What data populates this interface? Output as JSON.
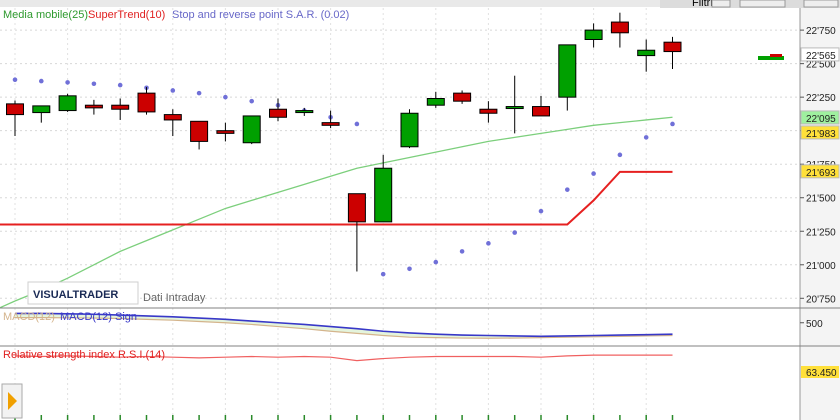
{
  "toolbar": {
    "filter_label": "Filtri"
  },
  "legend": {
    "ma": "Media mobile(25)",
    "st": "SuperTrend(10)",
    "sar": "Stop and reverse point S.A.R. (0.02)",
    "macd_a": "MACD(12)",
    "macd_b": "MACD(12) Sign",
    "rsi": "Relative strength index R.S.I.(14)"
  },
  "watermark": {
    "brand": "VISUALTRADER",
    "mode": "Dati Intraday"
  },
  "colors": {
    "up": "#00a000",
    "down": "#cc0000",
    "ma": "#7ccf7c",
    "st": "#e62020",
    "sar": "#7070d8",
    "macd": "#3838c8",
    "macd_sign": "#d4b48c",
    "rsi": "#f06060",
    "tag_yellow": "#ffe03a",
    "tag_green": "#9ff09f",
    "tag_white": "#ffffff"
  },
  "chart_data": {
    "type": "candlestick",
    "y_ticks": [
      "22'750",
      "22'500",
      "22'250",
      "22'000",
      "21'750",
      "21'500",
      "21'250",
      "21'000",
      "20'750"
    ],
    "tick_values": [
      22750,
      22500,
      22250,
      22000,
      21750,
      21500,
      21250,
      21000,
      20750
    ],
    "price_range": [
      20700,
      22900
    ],
    "candles": [
      {
        "o": 22200,
        "h": 22225,
        "l": 21960,
        "c": 22120
      },
      {
        "o": 22135,
        "h": 22185,
        "l": 22060,
        "c": 22185
      },
      {
        "o": 22150,
        "h": 22275,
        "l": 22140,
        "c": 22260
      },
      {
        "o": 22190,
        "h": 22230,
        "l": 22120,
        "c": 22170
      },
      {
        "o": 22190,
        "h": 22240,
        "l": 22080,
        "c": 22160
      },
      {
        "o": 22280,
        "h": 22325,
        "l": 22120,
        "c": 22140
      },
      {
        "o": 22120,
        "h": 22160,
        "l": 21960,
        "c": 22080
      },
      {
        "o": 22070,
        "h": 22070,
        "l": 21860,
        "c": 21920
      },
      {
        "o": 22000,
        "h": 22060,
        "l": 21920,
        "c": 21980
      },
      {
        "o": 21910,
        "h": 22110,
        "l": 21900,
        "c": 22110
      },
      {
        "o": 22160,
        "h": 22240,
        "l": 22070,
        "c": 22100
      },
      {
        "o": 22140,
        "h": 22170,
        "l": 22110,
        "c": 22150
      },
      {
        "o": 22060,
        "h": 22150,
        "l": 22020,
        "c": 22040
      },
      {
        "o": 21530,
        "h": 21530,
        "l": 20950,
        "c": 21320
      },
      {
        "o": 21320,
        "h": 21820,
        "l": 21320,
        "c": 21720
      },
      {
        "o": 21880,
        "h": 22160,
        "l": 21870,
        "c": 22130
      },
      {
        "o": 22190,
        "h": 22290,
        "l": 22170,
        "c": 22240
      },
      {
        "o": 22280,
        "h": 22300,
        "l": 22200,
        "c": 22220
      },
      {
        "o": 22160,
        "h": 22220,
        "l": 22060,
        "c": 22130
      },
      {
        "o": 22180,
        "h": 22410,
        "l": 21980,
        "c": 22180
      },
      {
        "o": 22180,
        "h": 22260,
        "l": 22120,
        "c": 22110
      },
      {
        "o": 22250,
        "h": 22520,
        "l": 22150,
        "c": 22640
      },
      {
        "o": 22680,
        "h": 22800,
        "l": 22620,
        "c": 22750
      },
      {
        "o": 22810,
        "h": 22880,
        "l": 22620,
        "c": 22730
      },
      {
        "o": 22560,
        "h": 22680,
        "l": 22440,
        "c": 22600
      },
      {
        "o": 22660,
        "h": 22700,
        "l": 22460,
        "c": 22590
      }
    ],
    "ma_line": [
      20730,
      20810,
      20900,
      21000,
      21100,
      21180,
      21260,
      21340,
      21420,
      21480,
      21540,
      21600,
      21660,
      21720,
      21760,
      21800,
      21840,
      21880,
      21920,
      21950,
      21980,
      22010,
      22040,
      22060,
      22080,
      22100
    ],
    "supertrend": [
      21300,
      21300,
      21300,
      21300,
      21300,
      21300,
      21300,
      21300,
      21300,
      21300,
      21300,
      21300,
      21300,
      21300,
      21300,
      21300,
      21300,
      21300,
      21300,
      21300,
      21300,
      21300,
      21480,
      21693,
      21693,
      21693
    ],
    "sar": [
      22380,
      22370,
      22360,
      22350,
      22340,
      22320,
      22300,
      22280,
      22250,
      22220,
      22190,
      22150,
      22100,
      22050,
      20930,
      20970,
      21020,
      21100,
      21160,
      21240,
      21400,
      21560,
      21680,
      21820,
      21950,
      22050
    ],
    "price_labels": [
      {
        "text": "22'565",
        "value": 22565,
        "bg": "tag_white"
      },
      {
        "text": "22'095",
        "value": 22095,
        "bg": "tag_green"
      },
      {
        "text": "21'983",
        "value": 21983,
        "bg": "tag_yellow"
      },
      {
        "text": "21'693",
        "value": 21693,
        "bg": "tag_yellow"
      }
    ],
    "macd_ticks": [
      "500"
    ],
    "macd": [
      610,
      610,
      605,
      600,
      590,
      580,
      570,
      555,
      540,
      520,
      500,
      480,
      455,
      430,
      400,
      380,
      365,
      355,
      350,
      345,
      340,
      345,
      350,
      355,
      360,
      365
    ],
    "macd_sign": [
      560,
      560,
      558,
      555,
      550,
      540,
      530,
      515,
      500,
      480,
      455,
      430,
      400,
      375,
      350,
      330,
      325,
      320,
      318,
      320,
      325,
      330,
      335,
      340,
      345,
      350
    ],
    "rsi_label": "63.450",
    "rsi": [
      62,
      61,
      62,
      61,
      60,
      61,
      60,
      59,
      60,
      61,
      60,
      61,
      60,
      55,
      58,
      60,
      61,
      61,
      61,
      61,
      60,
      62,
      63,
      63,
      63,
      63
    ]
  }
}
